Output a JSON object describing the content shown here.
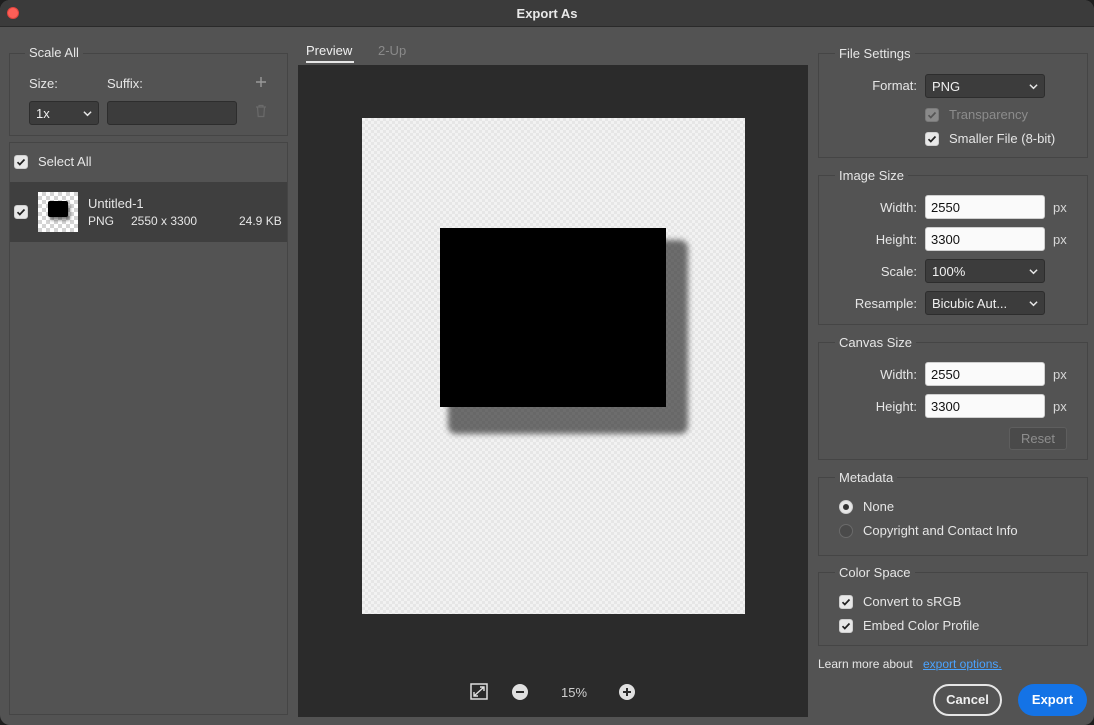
{
  "window": {
    "title": "Export As"
  },
  "left": {
    "scale_all": "Scale All",
    "size_label": "Size:",
    "suffix_label": "Suffix:",
    "size_value": "1x",
    "suffix_value": "",
    "select_all": "Select All",
    "asset": {
      "name": "Untitled-1",
      "format": "PNG",
      "dimensions": "2550 x 3300",
      "filesize": "24.9 KB"
    }
  },
  "tabs": [
    {
      "label": "Preview",
      "active": true
    },
    {
      "label": "2-Up",
      "active": false
    }
  ],
  "zoom": {
    "level": "15%"
  },
  "file_settings": {
    "title": "File Settings",
    "format_label": "Format:",
    "format_value": "PNG",
    "transparency": "Transparency",
    "smaller_file": "Smaller File (8-bit)"
  },
  "image_size": {
    "title": "Image Size",
    "width_label": "Width:",
    "width_value": "2550",
    "width_unit": "px",
    "height_label": "Height:",
    "height_value": "3300",
    "height_unit": "px",
    "scale_label": "Scale:",
    "scale_value": "100%",
    "resample_label": "Resample:",
    "resample_value": "Bicubic Aut..."
  },
  "canvas_size": {
    "title": "Canvas Size",
    "width_label": "Width:",
    "width_value": "2550",
    "width_unit": "px",
    "height_label": "Height:",
    "height_value": "3300",
    "height_unit": "px",
    "reset": "Reset"
  },
  "metadata": {
    "title": "Metadata",
    "none": "None",
    "copyright": "Copyright and Contact Info"
  },
  "color_space": {
    "title": "Color Space",
    "convert": "Convert to sRGB",
    "embed": "Embed Color Profile"
  },
  "footer": {
    "learn_more": "Learn more about",
    "link": "export options.",
    "cancel": "Cancel",
    "export": "Export"
  },
  "colors": {
    "accent": "#1473e6",
    "link": "#4aa3ff",
    "panel": "#535353",
    "canvas_bg": "#2b2b2b"
  }
}
